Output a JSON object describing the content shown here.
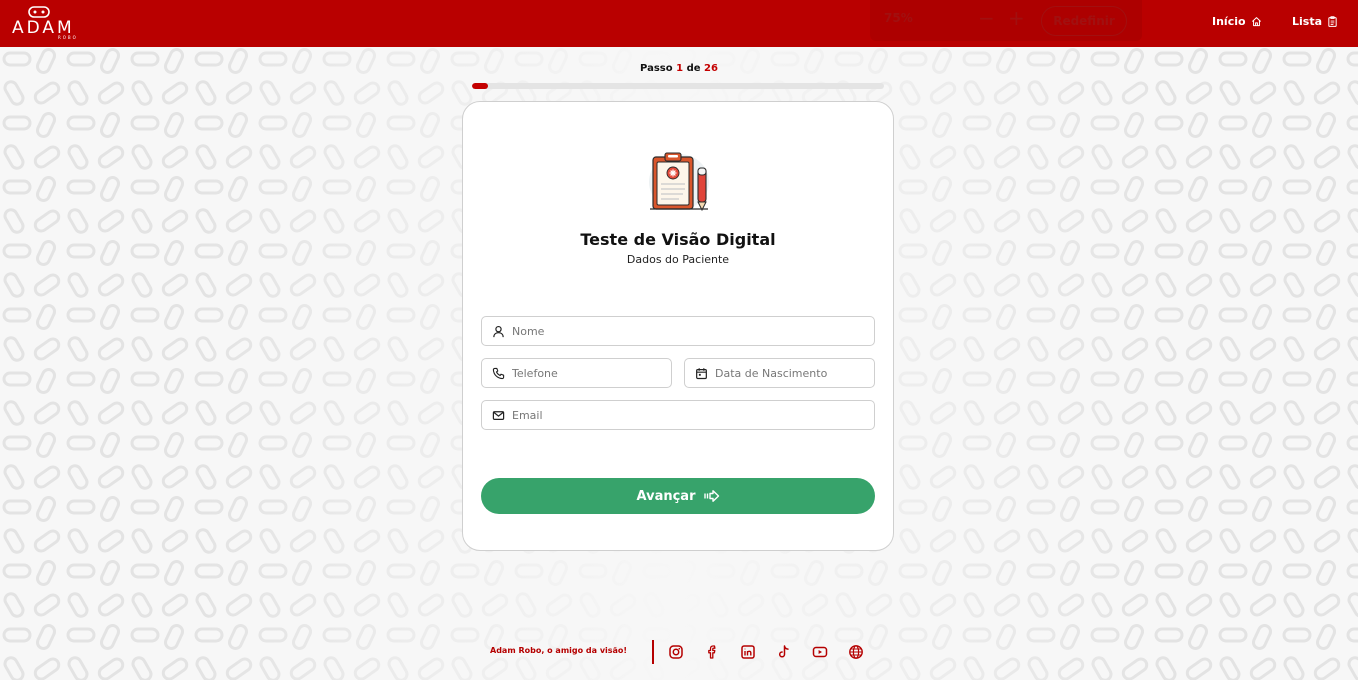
{
  "colors": {
    "brand_red": "#b90000",
    "accent_red": "#c40000",
    "button_green": "#37a36b",
    "background": "#f7f7f7"
  },
  "header": {
    "logo_text": "ADAM",
    "logo_sub": "ROBO",
    "zoom": {
      "level": "75%",
      "minus": "−",
      "plus": "+",
      "reset_label": "Redefinir"
    },
    "nav": {
      "home_label": "Início",
      "home_icon": "home-icon",
      "list_label": "Lista",
      "list_icon": "clipboard-list-icon"
    }
  },
  "progress": {
    "prefix": "Passo",
    "current": "1",
    "separator": "de",
    "total": "26",
    "fraction": 0.0385
  },
  "card": {
    "illustration": "clipboard-medical-icon",
    "title": "Teste de Visão Digital",
    "subtitle": "Dados do Paciente",
    "fields": {
      "name": {
        "placeholder": "Nome",
        "value": "",
        "icon": "user-icon"
      },
      "phone": {
        "placeholder": "Telefone",
        "value": "",
        "icon": "phone-icon"
      },
      "birth": {
        "placeholder": "Data de Nascimento",
        "value": "",
        "icon": "calendar-icon"
      },
      "email": {
        "placeholder": "Email",
        "value": "",
        "icon": "mail-icon"
      }
    },
    "next_button": {
      "label": "Avançar",
      "icon": "arrow-right-icon"
    }
  },
  "footer": {
    "tagline": "Adam Robo, o amigo da visão!",
    "social": [
      "instagram-icon",
      "facebook-icon",
      "linkedin-icon",
      "tiktok-icon",
      "youtube-icon",
      "globe-icon"
    ]
  }
}
